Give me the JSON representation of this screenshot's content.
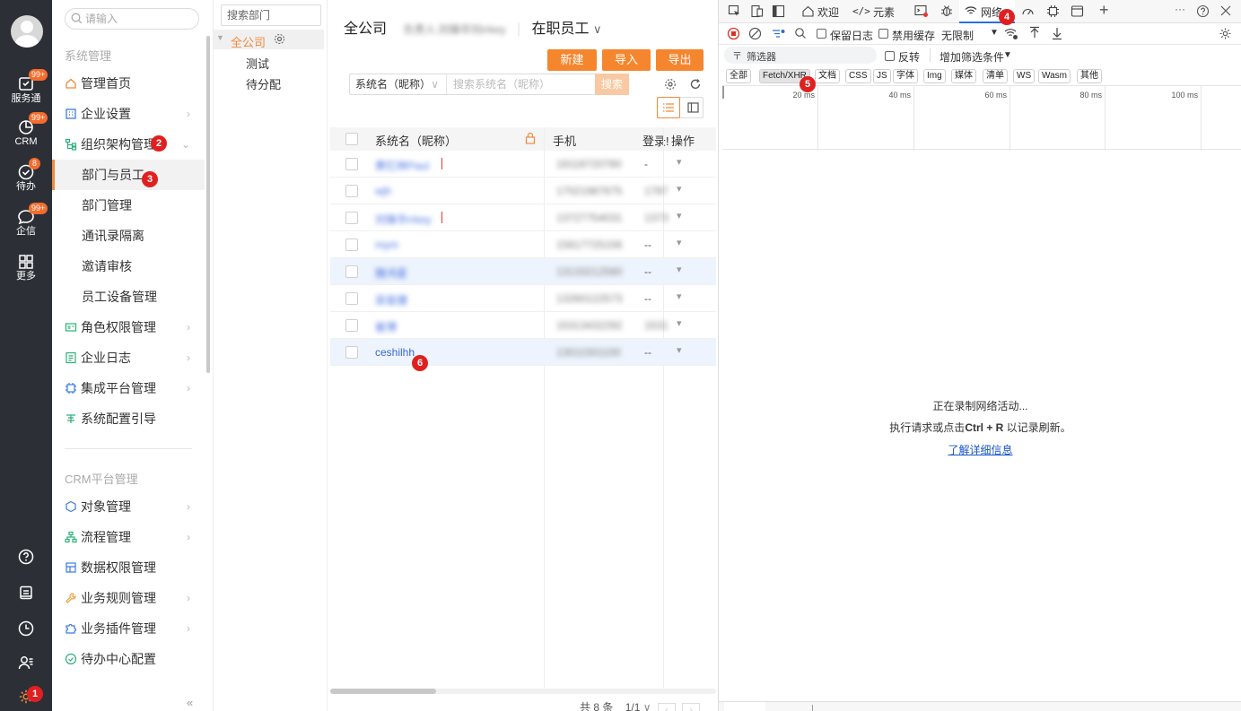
{
  "rail": {
    "items": [
      {
        "label": "服务通",
        "badge": "99+"
      },
      {
        "label": "CRM",
        "badge": "99+"
      },
      {
        "label": "待办",
        "badge": "8"
      },
      {
        "label": "企信",
        "badge": "99+"
      },
      {
        "label": "更多",
        "badge": ""
      }
    ]
  },
  "menu": {
    "search_placeholder": "请输入",
    "section1": "系统管理",
    "items1": [
      "管理首页",
      "企业设置",
      "组织架构管理"
    ],
    "subitems": [
      "部门与员工",
      "部门管理",
      "通讯录隔离",
      "邀请审核",
      "员工设备管理"
    ],
    "items2": [
      "角色权限管理",
      "企业日志",
      "集成平台管理",
      "系统配置引导"
    ],
    "section2": "CRM平台管理",
    "items3": [
      "对象管理",
      "流程管理",
      "数据权限管理",
      "业务规则管理",
      "业务插件管理",
      "待办中心配置"
    ],
    "collapse": "«"
  },
  "tree": {
    "search_placeholder": "搜索部门",
    "root": "全公司",
    "children": [
      "测试",
      "待分配"
    ]
  },
  "main": {
    "title": "全公司",
    "owner": "负责人:刘锋华刘rrkey",
    "status": "在职员工",
    "buttons": [
      "新建",
      "导入",
      "导出"
    ],
    "search_field": "系统名（昵称）",
    "search_placeholder": "搜索系统名（昵称）",
    "search_button": "搜索",
    "columns": [
      "系统名（昵称）",
      "手机",
      "登录!",
      "操作"
    ],
    "rows": [
      {
        "name": "黄忆林Paul",
        "phone": "18118720780",
        "login": "-"
      },
      {
        "name": "wjh",
        "phone": "17021987675",
        "login": "1787"
      },
      {
        "name": "刘锋华rrkey",
        "phone": "13727754031",
        "login": "1373"
      },
      {
        "name": "mym",
        "phone": "15617725156",
        "login": "--"
      },
      {
        "name": "魏鸿星",
        "phone": "13133212560",
        "login": "--"
      },
      {
        "name": "吴俊捷",
        "phone": "13260122573",
        "login": "--"
      },
      {
        "name": "崔博",
        "phone": "15313432292",
        "login": "1531"
      },
      {
        "name": "ceshilhh",
        "phone": "13011501100",
        "login": "--"
      }
    ],
    "footer_count": "共 8 条",
    "footer_page": "1/1"
  },
  "devtools": {
    "tabs": [
      "欢迎",
      "元素",
      "网络"
    ],
    "preserve_log": "保留日志",
    "disable_cache": "禁用缓存",
    "throttle": "无限制",
    "filter_placeholder": "筛选器",
    "invert": "反转",
    "add_filter": "增加筛选条件",
    "chips": [
      "全部",
      "Fetch/XHR",
      "文档",
      "CSS",
      "JS",
      "字体",
      "Img",
      "媒体",
      "清单",
      "WS",
      "Wasm",
      "其他"
    ],
    "ticks": [
      "20 ms",
      "40 ms",
      "60 ms",
      "80 ms",
      "100 ms"
    ],
    "recording": "正在录制网络活动...",
    "hint_prefix": "执行请求或点击",
    "hint_key": "Ctrl + R",
    "hint_suffix": "以记录刷新。",
    "learn_more": "了解详细信息"
  },
  "markers": [
    "1",
    "2",
    "3",
    "4",
    "5",
    "6"
  ],
  "colors": {
    "accent": "#f5862e",
    "rail": "#2c2f36",
    "link": "#1a56c4",
    "marker": "#e02020"
  }
}
